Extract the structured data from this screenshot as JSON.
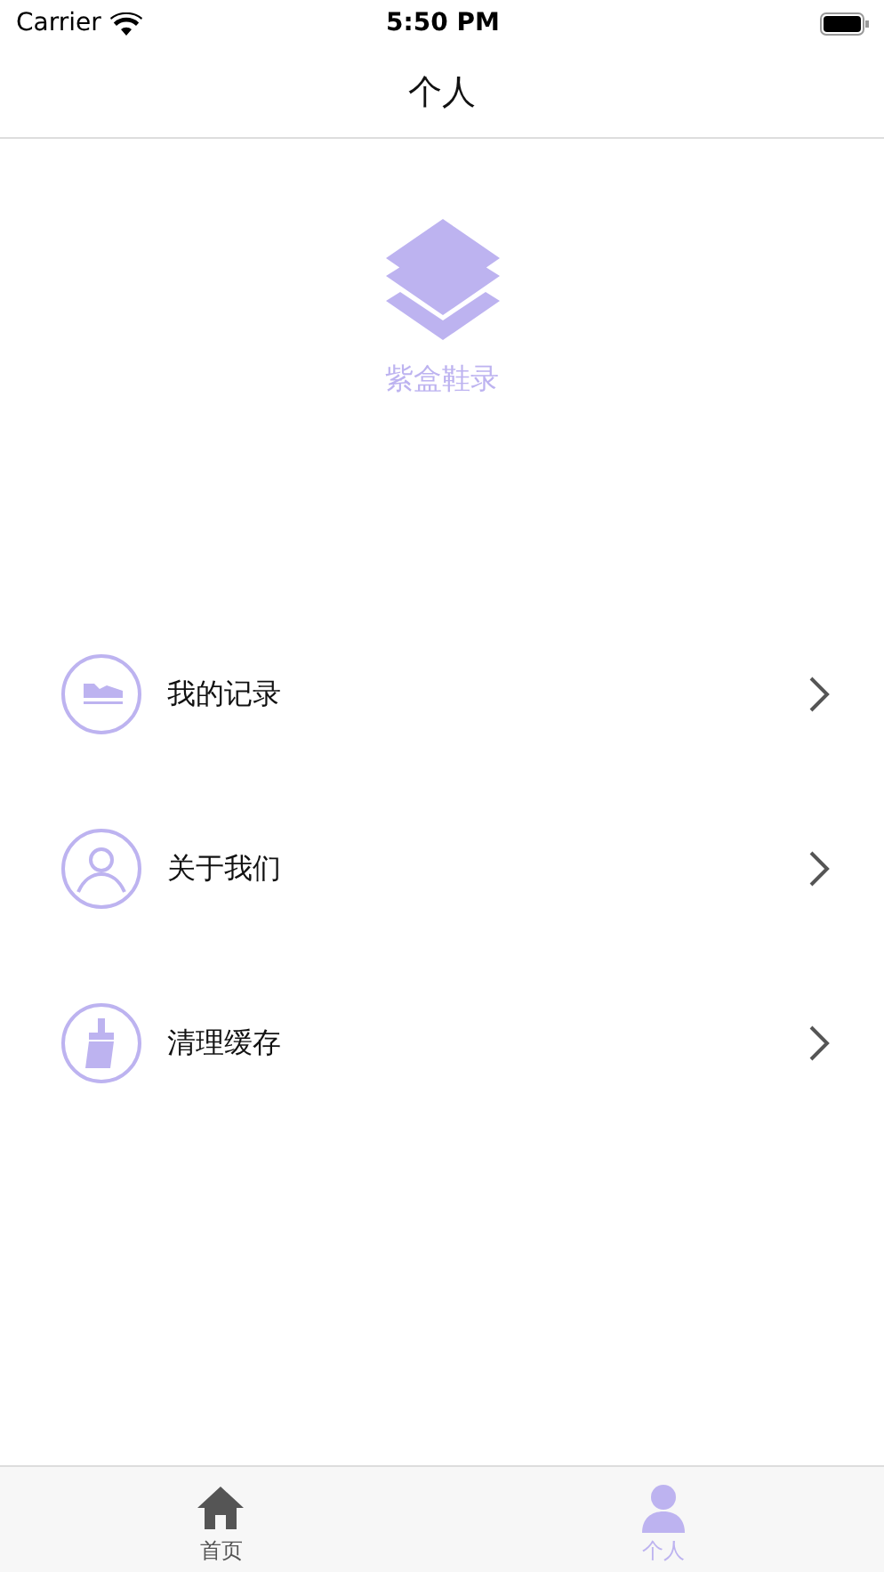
{
  "status_bar": {
    "carrier": "Carrier",
    "time": "5:50 PM"
  },
  "nav": {
    "title": "个人"
  },
  "app": {
    "name": "紫盒鞋录"
  },
  "menu": [
    {
      "kind": "shoe",
      "label": "我的记录"
    },
    {
      "kind": "person",
      "label": "关于我们"
    },
    {
      "kind": "brush",
      "label": "清理缓存"
    }
  ],
  "tabs": [
    {
      "kind": "home",
      "label": "首页",
      "selected": false
    },
    {
      "kind": "person",
      "label": "个人",
      "selected": true
    }
  ]
}
